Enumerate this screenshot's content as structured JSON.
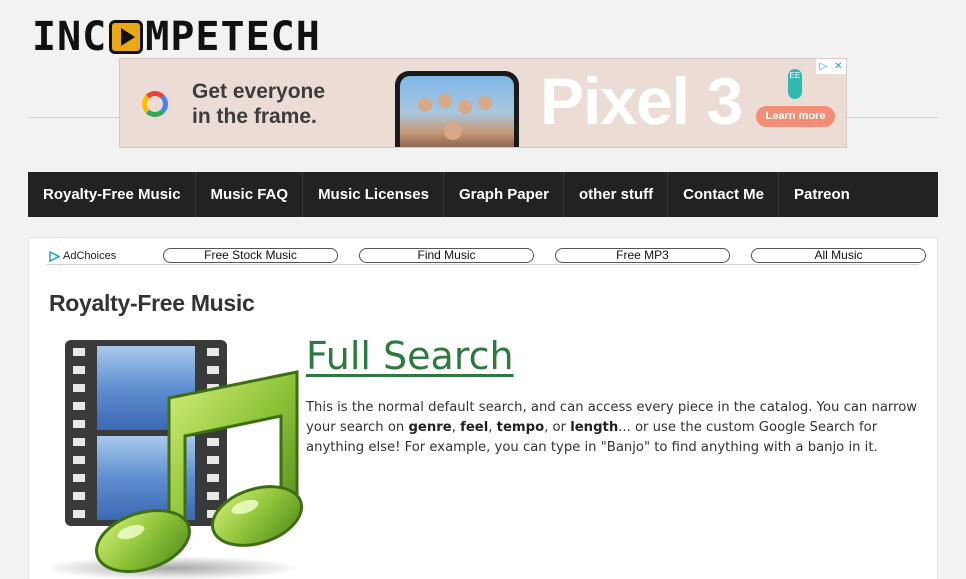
{
  "header": {
    "logo_prefix": "INC",
    "logo_suffix": "MPETECH"
  },
  "ad": {
    "headline": "Get everyone\nin the frame.",
    "product": "Pixel 3",
    "brand_badge": "EE",
    "cta": "Learn more",
    "corner_icons": [
      "adchoices-triangle-icon",
      "close-icon"
    ]
  },
  "nav": {
    "items": [
      {
        "label": "Royalty-Free Music"
      },
      {
        "label": "Music FAQ"
      },
      {
        "label": "Music Licenses"
      },
      {
        "label": "Graph Paper"
      },
      {
        "label": "other stuff"
      },
      {
        "label": "Contact Me"
      },
      {
        "label": "Patreon"
      }
    ]
  },
  "adlinks": {
    "adchoices_label": "AdChoices",
    "links": [
      {
        "label": "Free Stock Music"
      },
      {
        "label": "Find Music"
      },
      {
        "label": "Free MP3"
      },
      {
        "label": "All Music"
      }
    ]
  },
  "content": {
    "section_title": "Royalty-Free Music",
    "search_link": "Full Search",
    "desc_1": "This is the normal default search, and can access every piece in the catalog. You can narrow your search on ",
    "desc_genre": "genre",
    "desc_sep1": ", ",
    "desc_feel": "feel",
    "desc_sep2": ", ",
    "desc_tempo": "tempo",
    "desc_sep3": ", or ",
    "desc_length": "length",
    "desc_2": "... or use the custom Google Search for anything else! For example, you can type in \"Banjo\" to find anything with a banjo in it."
  },
  "colors": {
    "nav_bg": "#222222",
    "link_green": "#2c7a3f",
    "logo_accent": "#e8a817"
  }
}
